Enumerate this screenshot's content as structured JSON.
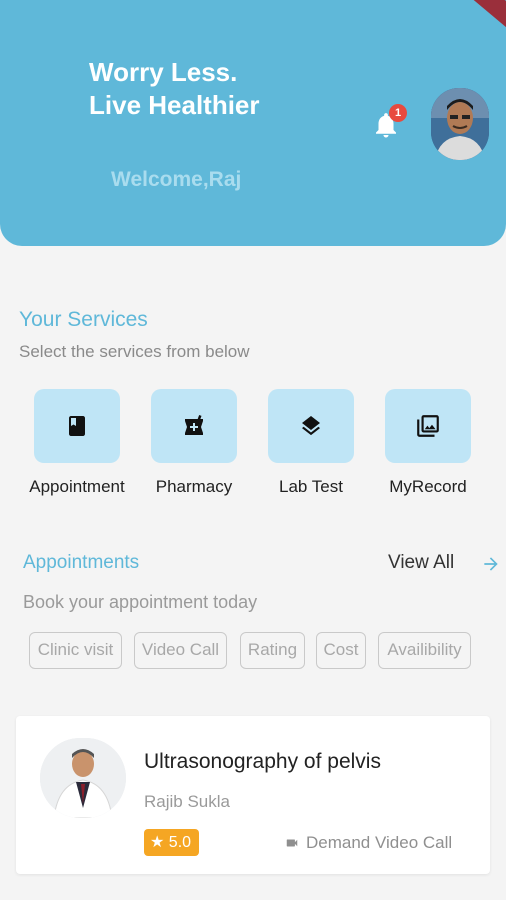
{
  "header": {
    "tagline_line1": "Worry Less.",
    "tagline_line2": "Live Healthier",
    "welcome": "Welcome,Raj",
    "notification_count": "1"
  },
  "services": {
    "title": "Your Services",
    "subtitle": "Select the services from below",
    "items": [
      {
        "label": "Appointment",
        "icon": "book-icon"
      },
      {
        "label": "Pharmacy",
        "icon": "pharmacy-icon"
      },
      {
        "label": "Lab Test",
        "icon": "layers-icon"
      },
      {
        "label": "MyRecord",
        "icon": "photo-library-icon"
      }
    ]
  },
  "appointments": {
    "title": "Appointments",
    "view_all": "View All",
    "subtitle": "Book your appointment today",
    "filters": [
      "Clinic visit",
      "Video Call",
      "Rating",
      "Cost",
      "Availibility"
    ]
  },
  "card": {
    "title": "Ultrasonography of pelvis",
    "doctor": "Rajib Sukla",
    "rating": "5.0",
    "mode": "Demand Video Call"
  },
  "colors": {
    "primary": "#5fb8d9",
    "tile": "#bfe5f6",
    "badge": "#f5a623",
    "notification": "#e84a3e"
  }
}
